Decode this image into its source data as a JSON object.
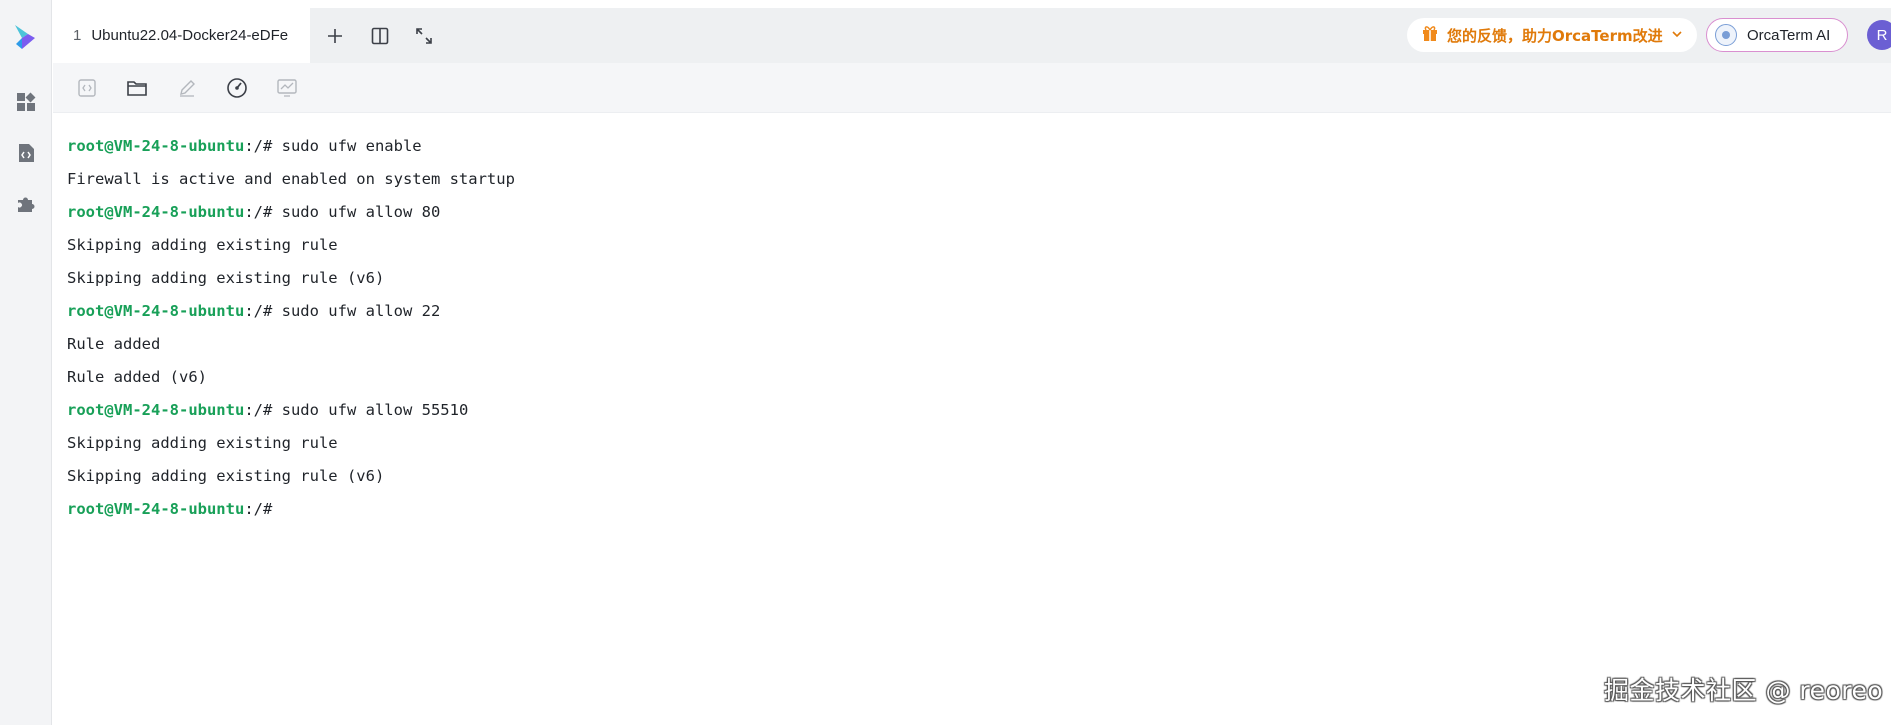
{
  "tabs": [
    {
      "number": "1",
      "label": "Ubuntu22.04-Docker24-eDFe"
    }
  ],
  "topbar": {
    "feedback_label": "您的反馈，助力OrcaTerm改进",
    "ai_label": "OrcaTerm AI",
    "avatar_initial": "R"
  },
  "sidebar": {
    "icons": [
      "grid-apps-icon",
      "code-file-icon",
      "puzzle-plugin-icon"
    ]
  },
  "toolbar": {
    "icons": [
      "code-snippet-icon",
      "folder-icon",
      "edit-pencil-icon",
      "gauge-icon",
      "monitor-chart-icon"
    ]
  },
  "terminal": {
    "prompt_user": "root@VM-24-8-ubuntu",
    "prompt_path": ":/#",
    "lines": [
      {
        "prompt": true,
        "text": " sudo ufw enable"
      },
      {
        "prompt": false,
        "text": "Firewall is active and enabled on system startup"
      },
      {
        "prompt": true,
        "text": " sudo ufw allow 80"
      },
      {
        "prompt": false,
        "text": "Skipping adding existing rule"
      },
      {
        "prompt": false,
        "text": "Skipping adding existing rule (v6)"
      },
      {
        "prompt": true,
        "text": " sudo ufw allow 22"
      },
      {
        "prompt": false,
        "text": "Rule added"
      },
      {
        "prompt": false,
        "text": "Rule added (v6)"
      },
      {
        "prompt": true,
        "text": " sudo ufw allow 55510"
      },
      {
        "prompt": false,
        "text": "Skipping adding existing rule"
      },
      {
        "prompt": false,
        "text": "Skipping adding existing rule (v6)"
      },
      {
        "prompt": true,
        "text": ""
      }
    ]
  },
  "watermark": "掘金技术社区 @ reoreo",
  "colors": {
    "prompt": "#18a058",
    "feedback": "#e07a0a",
    "avatar": "#6b5fd3"
  }
}
